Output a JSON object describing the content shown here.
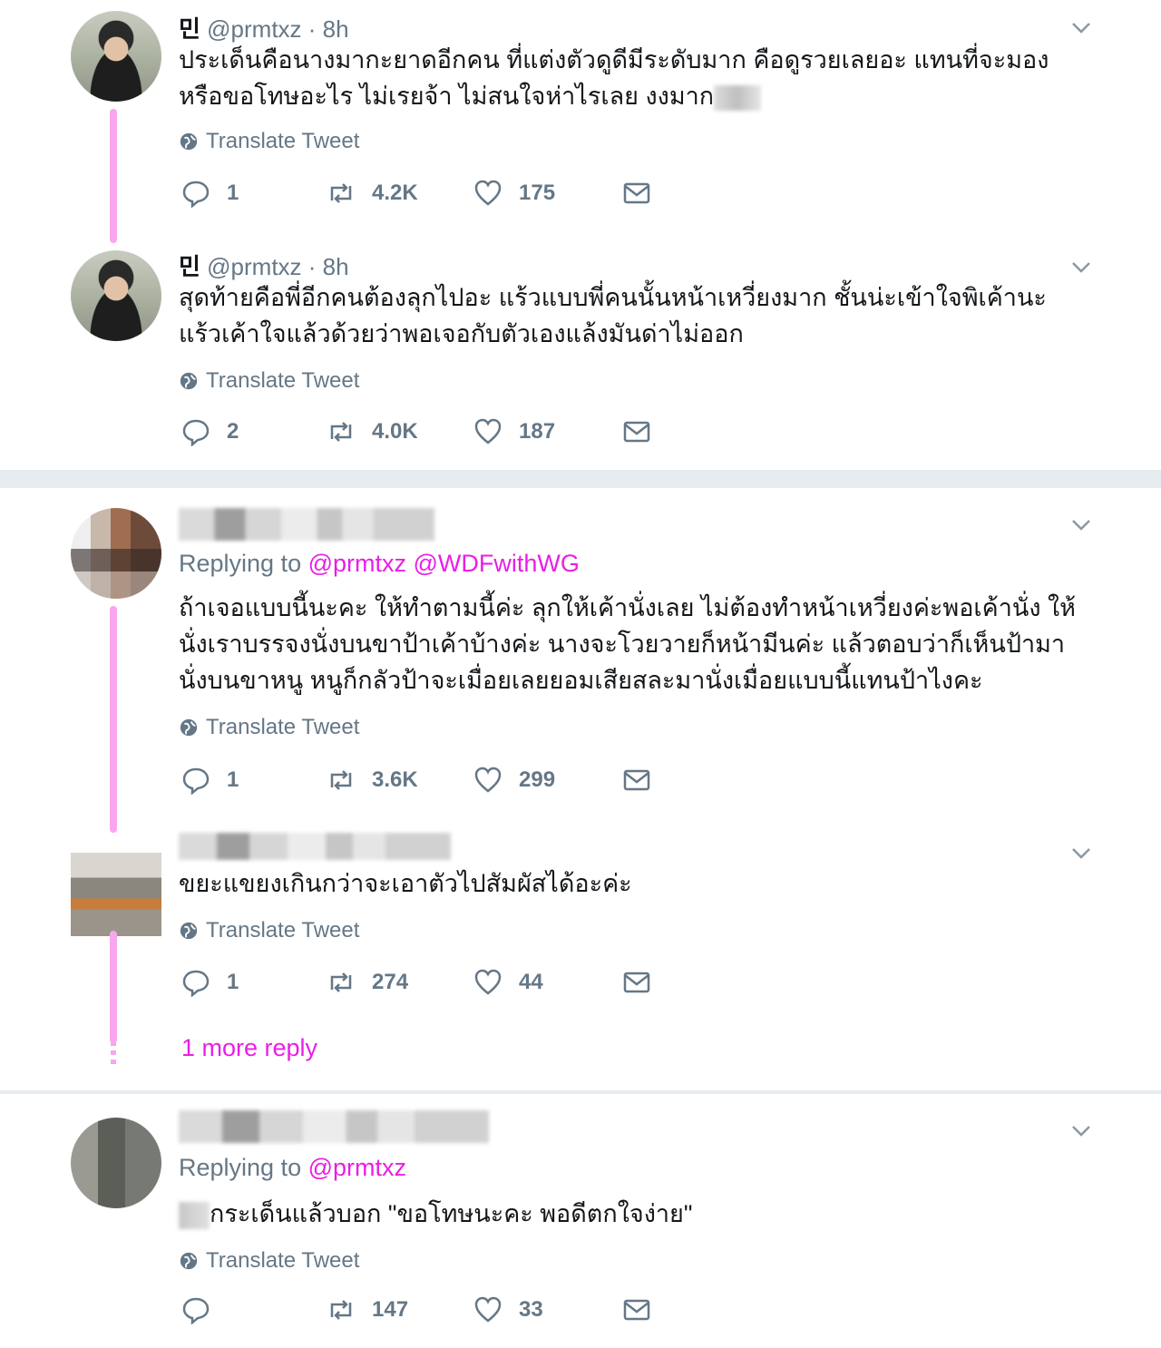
{
  "tweets": [
    {
      "name": "민",
      "handle": "@prmtxz",
      "time": "· 8h",
      "text": "ประเด็นคือนางมากะยาดอีกคน ที่แต่งตัวดูดีมีระดับมาก คือดูรวยเลยอะ แทนที่จะมองหรือขอโทษอะไร ไม่เรยจ้า ไม่สนใจห่าไรเลย งงมาก",
      "translate": "Translate Tweet",
      "replies": "1",
      "retweets": "4.2K",
      "likes": "175"
    },
    {
      "name": "민",
      "handle": "@prmtxz",
      "time": "· 8h",
      "text": "สุดท้ายคือพี่อีกคนต้องลุกไปอะ แร้วแบบพี่คนนั้นหน้าเหวี่ยงมาก ชั้นน่ะเข้าใจพิเค้านะ แร้วเค้าใจแล้วด้วยว่าพอเจอกับตัวเองแล้งมันด่าไม่ออก",
      "translate": "Translate Tweet",
      "replies": "2",
      "retweets": "4.0K",
      "likes": "187"
    },
    {
      "replying_prefix": "Replying to",
      "replying_mentions": "@prmtxz @WDFwithWG",
      "text": "ถ้าเจอแบบนี้นะคะ ให้ทำตามนี้ค่ะ ลุกให้เค้านั่งเลย ไม่ต้องทำหน้าเหวี่ยงค่ะพอเค้านั่ง ให้นั่งเราบรรจงนั่งบนขาป้าเค้าบ้างค่ะ นางจะโวยวายก็หน้ามีนค่ะ แล้วตอบว่าก็เห็นป้ามานั่งบนขาหนู หนูก็กลัวป้าจะเมื่อยเลยยอมเสียสละมานั่งเมื่อยแบบนี้แทนป้าไงคะ",
      "translate": "Translate Tweet",
      "replies": "1",
      "retweets": "3.6K",
      "likes": "299"
    },
    {
      "text": "ขยะแขยงเกินกว่าจะเอาตัวไปสัมผัสได้อะค่ะ",
      "translate": "Translate Tweet",
      "replies": "1",
      "retweets": "274",
      "likes": "44",
      "more_reply": "1 more reply"
    },
    {
      "replying_prefix": "Replying to",
      "replying_mentions": "@prmtxz",
      "text": "กระเด็นแล้วบอก \"ขอโทษนะคะ พอดีตกใจง่าย\"",
      "translate": "Translate Tweet",
      "replies": "",
      "retweets": "147",
      "likes": "33"
    }
  ],
  "icons": {
    "reply": "reply-icon",
    "retweet": "retweet-icon",
    "like": "heart-icon",
    "dm": "envelope-icon",
    "globe": "globe-icon",
    "chevron": "chevron-down-icon"
  },
  "colors": {
    "accent": "#e91ee6",
    "thread_line": "#f7a6ef",
    "muted": "#657786",
    "divider": "#e6ecf0"
  }
}
